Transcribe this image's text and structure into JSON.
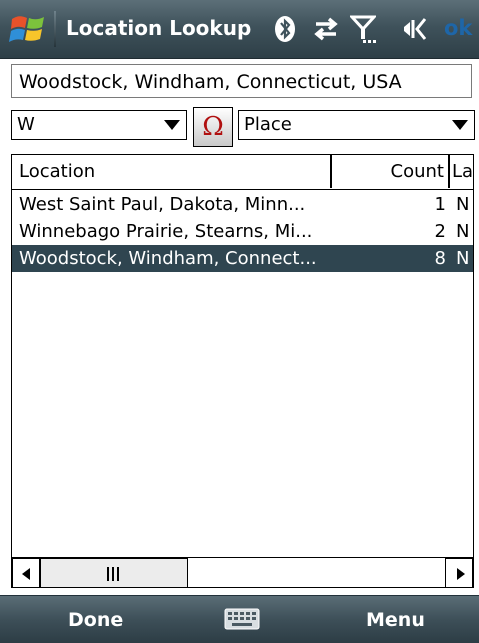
{
  "window": {
    "title": "Location Lookup",
    "ok_label": "ok"
  },
  "status_icons": [
    "bluetooth-icon",
    "connectivity-icon",
    "signal-icon",
    "volume-icon"
  ],
  "location_field": {
    "value": "Woodstock, Windham, Connecticut, USA"
  },
  "letter_select": {
    "value": "W"
  },
  "special_char_button": {
    "label": "Ω"
  },
  "type_select": {
    "value": "Place"
  },
  "list": {
    "columns": [
      "Location",
      "Count",
      "La"
    ],
    "rows": [
      {
        "location": "West Saint Paul, Dakota, Minn...",
        "count": "1",
        "extra": "N",
        "selected": false
      },
      {
        "location": "Winnebago Prairie, Stearns, Mi...",
        "count": "2",
        "extra": "N",
        "selected": false
      },
      {
        "location": "Woodstock, Windham, Connect...",
        "count": "8",
        "extra": "N",
        "selected": true
      }
    ]
  },
  "softkeys": {
    "left": "Done",
    "right": "Menu"
  },
  "colors": {
    "title_bar": "#3f525b",
    "selection": "#2f4550",
    "ok": "#1e66a8",
    "omega": "#b01010"
  }
}
